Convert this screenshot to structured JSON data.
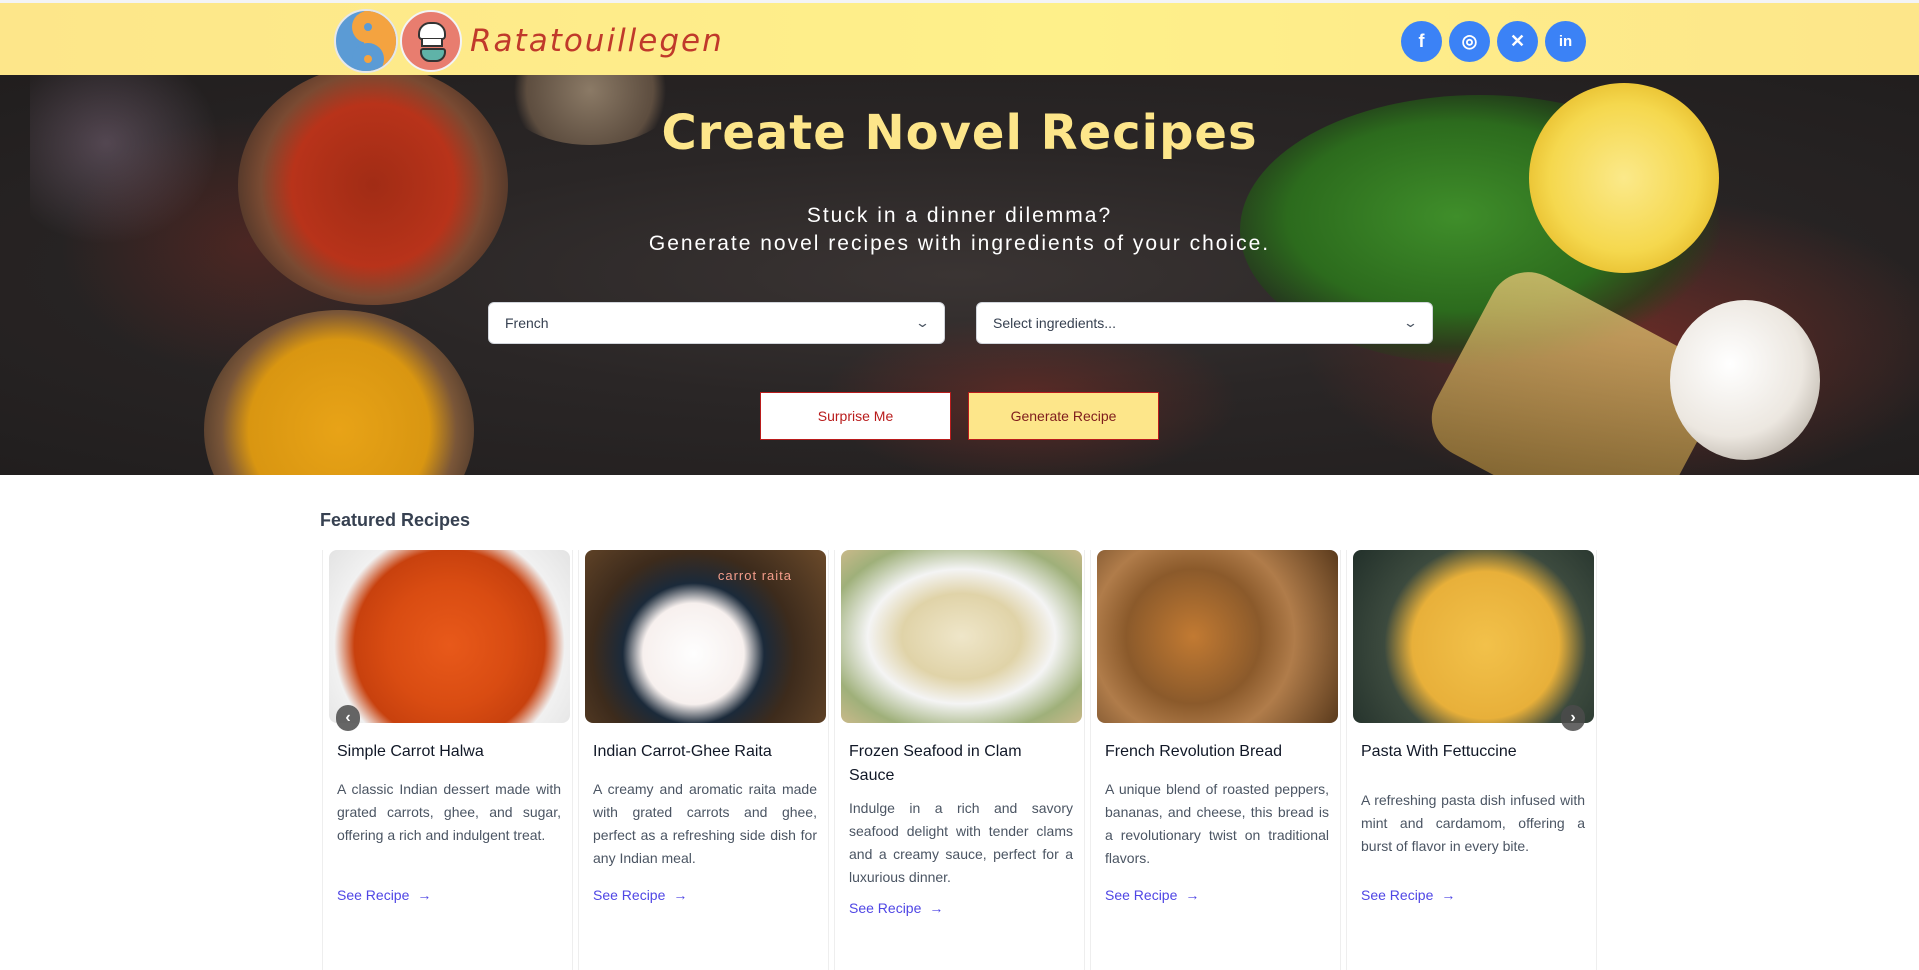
{
  "header": {
    "brand": "Ratatouillegen",
    "socials": [
      {
        "icon": "facebook-icon",
        "glyph": "f"
      },
      {
        "icon": "instagram-icon",
        "glyph": "◎"
      },
      {
        "icon": "x-icon",
        "glyph": "✕"
      },
      {
        "icon": "linkedin-icon",
        "glyph": "in"
      }
    ]
  },
  "hero": {
    "title": "Create Novel Recipes",
    "subtitle_line1": "Stuck in a dinner dilemma?",
    "subtitle_line2": "Generate novel recipes with ingredients of your choice.",
    "cuisine_select": "French",
    "ingredients_select": "Select ingredients...",
    "surprise_button": "Surprise Me",
    "generate_button": "Generate Recipe"
  },
  "featured": {
    "title": "Featured Recipes",
    "link_label": "See Recipe",
    "cards": [
      {
        "title": "Simple Carrot Halwa",
        "description": "A classic Indian dessert made with grated carrots, ghee, and sugar, offering a rich and indulgent treat."
      },
      {
        "title": "Indian Carrot-Ghee Raita",
        "description": "A creamy and aromatic raita made with grated carrots and ghee, perfect as a refreshing side dish for any Indian meal.",
        "image_text": "carrot raita"
      },
      {
        "title": "Frozen Seafood in Clam Sauce",
        "description": "Indulge in a rich and savory seafood delight with tender clams and a creamy sauce, perfect for a luxurious dinner."
      },
      {
        "title": "French Revolution Bread",
        "description": "A unique blend of roasted peppers, bananas, and cheese, this bread is a revolutionary twist on traditional flavors."
      },
      {
        "title": "Pasta With Fettuccine",
        "description": "A refreshing pasta dish infused with mint and cardamom, offering a burst of flavor in every bite."
      }
    ]
  },
  "colors": {
    "header_bg": "#fef08a",
    "brand_text": "#c0392b",
    "hero_title": "#fde68a",
    "social_bg": "#3b82f6",
    "link": "#4f46e5",
    "button_border": "#b91c1c"
  }
}
